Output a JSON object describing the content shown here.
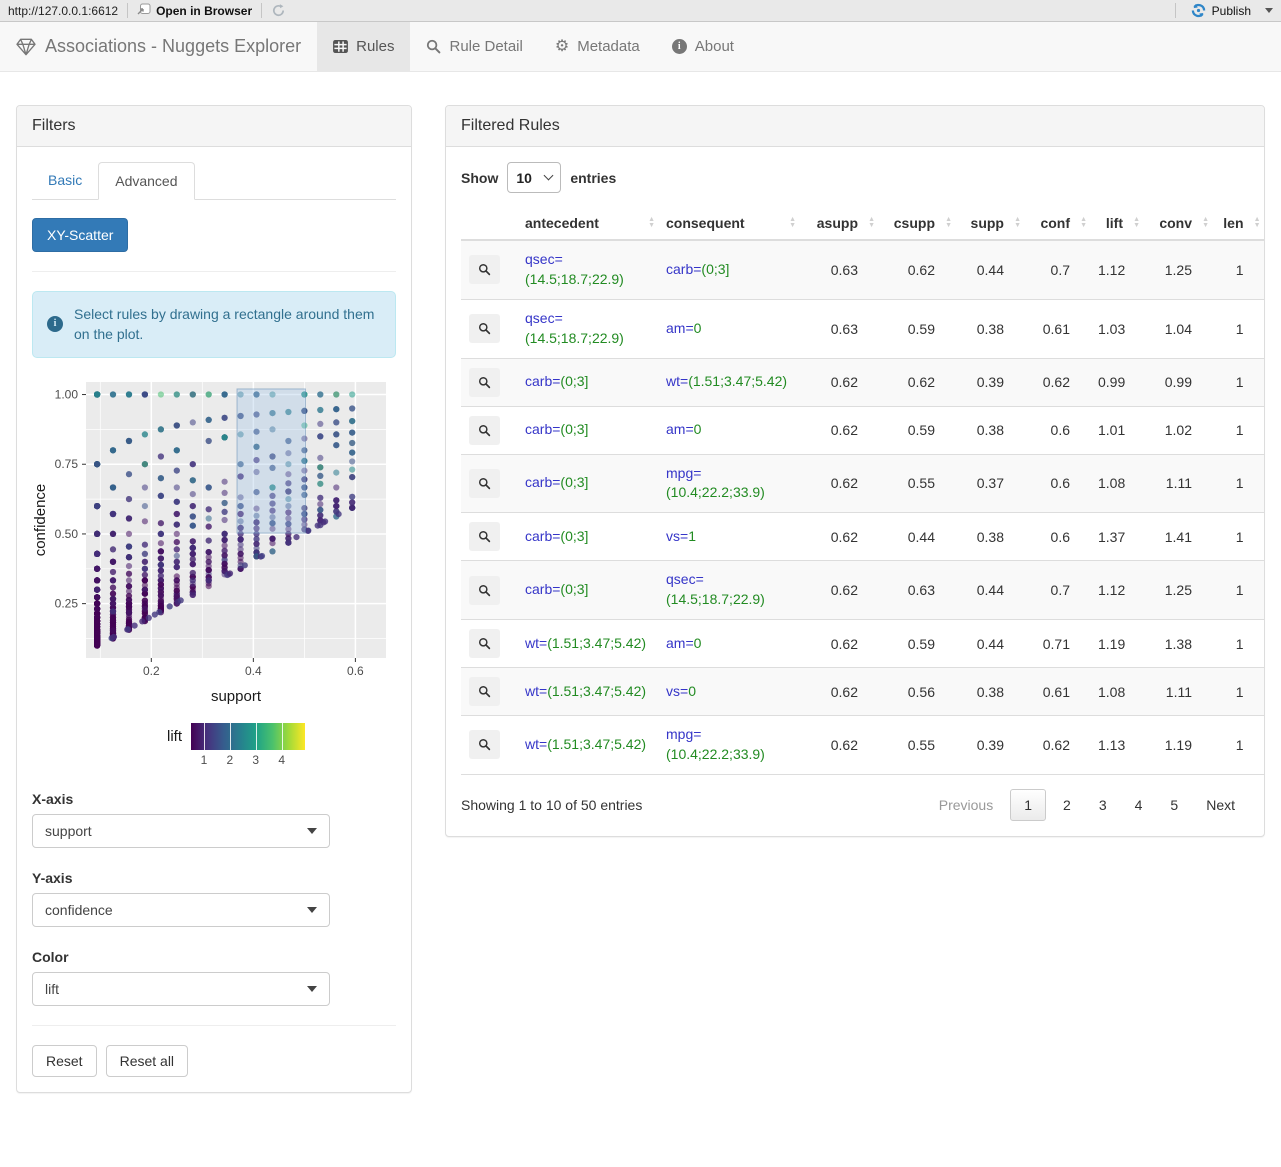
{
  "toolbar": {
    "url": "http://127.0.0.1:6612",
    "open_in_browser": "Open in Browser",
    "publish_label": "Publish"
  },
  "navbar": {
    "brand": "Associations - Nuggets Explorer",
    "tabs": [
      {
        "label": "Rules",
        "icon": "table-icon",
        "active": true
      },
      {
        "label": "Rule Detail",
        "icon": "magnifier-icon",
        "active": false
      },
      {
        "label": "Metadata",
        "icon": "gear-icon",
        "active": false
      },
      {
        "label": "About",
        "icon": "info-icon",
        "active": false
      }
    ]
  },
  "filters": {
    "title": "Filters",
    "tabs": [
      {
        "label": "Basic",
        "active": false
      },
      {
        "label": "Advanced",
        "active": true
      }
    ],
    "scatter_button": "XY-Scatter",
    "alert_text": "Select rules by drawing a rectangle around them on the plot.",
    "x_axis": {
      "label": "X-axis",
      "value": "support"
    },
    "y_axis": {
      "label": "Y-axis",
      "value": "confidence"
    },
    "color": {
      "label": "Color",
      "value": "lift"
    },
    "reset_label": "Reset",
    "reset_all_label": "Reset all"
  },
  "chart_data": {
    "type": "scatter",
    "xlabel": "support",
    "ylabel": "confidence",
    "xlim": [
      0.072,
      0.66
    ],
    "ylim": [
      0.055,
      1.045
    ],
    "xticks": [
      {
        "v": 0.2,
        "label": "0.2"
      },
      {
        "v": 0.4,
        "label": "0.4"
      },
      {
        "v": 0.6,
        "label": "0.6"
      }
    ],
    "yticks": [
      {
        "v": 0.25,
        "label": "0.25"
      },
      {
        "v": 0.5,
        "label": "0.50"
      },
      {
        "v": 0.75,
        "label": "0.75"
      },
      {
        "v": 1.0,
        "label": "1.00"
      }
    ],
    "xminor": [
      0.1,
      0.3,
      0.5
    ],
    "yminor": [
      0.125,
      0.375,
      0.625,
      0.875
    ],
    "panel_color": "#ebebeb",
    "legend": {
      "label": "lift",
      "domain": [
        0.5,
        4.9
      ],
      "ticks": [
        1,
        2,
        3,
        4
      ],
      "palette": "viridis"
    },
    "selection_rect": {
      "x0": 0.368,
      "x1": 0.502,
      "y0": 0.503,
      "y1": 1.02,
      "fill": "rgba(160,196,228,0.35)",
      "stroke": "rgba(100,140,180,0.55)"
    },
    "points": {
      "description": "dense triangular cloud of association rules, confidence >= support, diagonal ray patterns from discrete mtcars supports (k/32), colored by lift (viridis), alpha-blended",
      "seed": 20,
      "count": 1500,
      "radius": 3.1,
      "opacity": 0.55
    }
  },
  "rules_panel": {
    "title": "Filtered Rules",
    "show_label": "Show",
    "entries_label": "entries",
    "page_length": "10",
    "columns": [
      "antecedent",
      "consequent",
      "asupp",
      "csupp",
      "supp",
      "conf",
      "lift",
      "conv",
      "len"
    ],
    "rows": [
      {
        "antecedent": {
          "n": "qsec=",
          "v": "(14.5;18.7;22.9)"
        },
        "consequent": {
          "n": "carb=",
          "v": "(0;3]"
        },
        "vals": [
          0.63,
          0.62,
          0.44,
          0.7,
          1.12,
          1.25,
          1
        ]
      },
      {
        "antecedent": {
          "n": "qsec=",
          "v": "(14.5;18.7;22.9)"
        },
        "consequent": {
          "n": "am=",
          "v": "0"
        },
        "vals": [
          0.63,
          0.59,
          0.38,
          0.61,
          1.03,
          1.04,
          1
        ]
      },
      {
        "antecedent": {
          "n": "carb=",
          "v": "(0;3]"
        },
        "consequent": {
          "n": "wt=",
          "v": "(1.51;3.47;5.42)"
        },
        "vals": [
          0.62,
          0.62,
          0.39,
          0.62,
          0.99,
          0.99,
          1
        ]
      },
      {
        "antecedent": {
          "n": "carb=",
          "v": "(0;3]"
        },
        "consequent": {
          "n": "am=",
          "v": "0"
        },
        "vals": [
          0.62,
          0.59,
          0.38,
          0.6,
          1.01,
          1.02,
          1
        ]
      },
      {
        "antecedent": {
          "n": "carb=",
          "v": "(0;3]"
        },
        "consequent": {
          "n": "mpg=",
          "v": "(10.4;22.2;33.9)"
        },
        "vals": [
          0.62,
          0.55,
          0.37,
          0.6,
          1.08,
          1.11,
          1
        ]
      },
      {
        "antecedent": {
          "n": "carb=",
          "v": "(0;3]"
        },
        "consequent": {
          "n": "vs=",
          "v": "1"
        },
        "vals": [
          0.62,
          0.44,
          0.38,
          0.6,
          1.37,
          1.41,
          1
        ]
      },
      {
        "antecedent": {
          "n": "carb=",
          "v": "(0;3]"
        },
        "consequent": {
          "n": "qsec=",
          "v": "(14.5;18.7;22.9)"
        },
        "vals": [
          0.62,
          0.63,
          0.44,
          0.7,
          1.12,
          1.25,
          1
        ]
      },
      {
        "antecedent": {
          "n": "wt=",
          "v": "(1.51;3.47;5.42)"
        },
        "consequent": {
          "n": "am=",
          "v": "0"
        },
        "vals": [
          0.62,
          0.59,
          0.44,
          0.71,
          1.19,
          1.38,
          1
        ]
      },
      {
        "antecedent": {
          "n": "wt=",
          "v": "(1.51;3.47;5.42)"
        },
        "consequent": {
          "n": "vs=",
          "v": "0"
        },
        "vals": [
          0.62,
          0.56,
          0.38,
          0.61,
          1.08,
          1.11,
          1
        ]
      },
      {
        "antecedent": {
          "n": "wt=",
          "v": "(1.51;3.47;5.42)"
        },
        "consequent": {
          "n": "mpg=",
          "v": "(10.4;22.2;33.9)"
        },
        "vals": [
          0.62,
          0.55,
          0.39,
          0.62,
          1.13,
          1.19,
          1
        ]
      }
    ],
    "info": "Showing 1 to 10 of 50 entries",
    "pagination": {
      "previous": "Previous",
      "pages": [
        "1",
        "2",
        "3",
        "4",
        "5"
      ],
      "current": "1",
      "next": "Next"
    }
  },
  "colors": {
    "accent_blue": "#337ab7",
    "antecedent_name": "#3535c8",
    "antecedent_value": "#228b22",
    "alert_bg": "#d9edf7",
    "alert_text": "#31708f",
    "publish_icon": "#2f86c8"
  }
}
